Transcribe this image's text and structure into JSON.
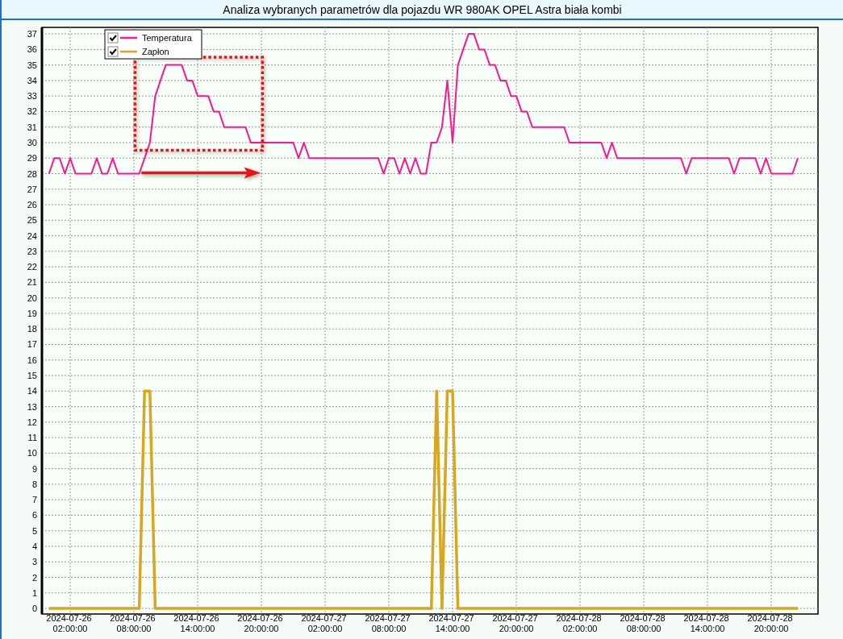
{
  "window": {
    "title": "Analiza wybranych parametrów dla pojazdu WR 980AK OPEL Astra biała kombi"
  },
  "chart": {
    "legend_checkboxes": [
      {
        "checked": true
      },
      {
        "checked": true
      }
    ],
    "chart_data": {
      "type": "line",
      "grid": true,
      "legend": true,
      "ylim": [
        -0.36,
        37.42
      ],
      "yticks": [
        0,
        1,
        2,
        3,
        4,
        5,
        6,
        7,
        8,
        9,
        10,
        11,
        12,
        13,
        14,
        15,
        16,
        17,
        18,
        19,
        20,
        21,
        22,
        23,
        24,
        25,
        26,
        27,
        28,
        29,
        30,
        31,
        32,
        33,
        34,
        35,
        36,
        37
      ],
      "categories": [
        null,
        null,
        null,
        null,
        "2024-07-26 02:00:00",
        null,
        null,
        null,
        null,
        null,
        null,
        null,
        null,
        null,
        null,
        null,
        "2024-07-26 08:00:00",
        null,
        null,
        null,
        null,
        null,
        null,
        null,
        null,
        null,
        null,
        null,
        "2024-07-26 14:00:00",
        null,
        null,
        null,
        null,
        null,
        null,
        null,
        null,
        null,
        null,
        null,
        "2024-07-26 20:00:00",
        null,
        null,
        null,
        null,
        null,
        null,
        null,
        null,
        null,
        null,
        null,
        "2024-07-27 02:00:00",
        null,
        null,
        null,
        null,
        null,
        null,
        null,
        null,
        null,
        null,
        null,
        "2024-07-27 08:00:00",
        null,
        null,
        null,
        null,
        null,
        null,
        null,
        null,
        null,
        null,
        null,
        "2024-07-27 14:00:00",
        null,
        null,
        null,
        null,
        null,
        null,
        null,
        null,
        null,
        null,
        null,
        "2024-07-27 20:00:00",
        null,
        null,
        null,
        null,
        null,
        null,
        null,
        null,
        null,
        null,
        null,
        "2024-07-28 02:00:00",
        null,
        null,
        null,
        null,
        null,
        null,
        null,
        null,
        null,
        null,
        null,
        "2024-07-28 08:00:00",
        null,
        null,
        null,
        null,
        null,
        null,
        null,
        null,
        null,
        null,
        null,
        "2024-07-28 14:00:00",
        null,
        null,
        null,
        null,
        null,
        null,
        null,
        null,
        null,
        null,
        null,
        "2024-07-28 20:00:00",
        null,
        null,
        null,
        null,
        null
      ],
      "series": [
        {
          "name": "Temperatura",
          "color": "#ff1493",
          "values": [
            28,
            29,
            29,
            28,
            29,
            28,
            28,
            28,
            28,
            29,
            28,
            28,
            29,
            28,
            28,
            28,
            28,
            28,
            29,
            30,
            33,
            34,
            35,
            35,
            35,
            35,
            34,
            34,
            33,
            33,
            33,
            32,
            32,
            31,
            31,
            31,
            31,
            31,
            30,
            30,
            30,
            30,
            30,
            30,
            30,
            30,
            30,
            29,
            30,
            29,
            29,
            29,
            29,
            29,
            29,
            29,
            29,
            29,
            29,
            29,
            29,
            29,
            29,
            28,
            29,
            29,
            28,
            29,
            28,
            29,
            28,
            28,
            30,
            30,
            31,
            34,
            30,
            35,
            36,
            37,
            37,
            36,
            36,
            35,
            35,
            34,
            34,
            33,
            33,
            32,
            32,
            31,
            31,
            31,
            31,
            31,
            31,
            31,
            30,
            30,
            30,
            30,
            30,
            30,
            30,
            29,
            30,
            29,
            29,
            29,
            29,
            29,
            29,
            29,
            29,
            29,
            29,
            29,
            29,
            29,
            28,
            29,
            29,
            29,
            29,
            29,
            29,
            29,
            29,
            28,
            29,
            29,
            29,
            29,
            28,
            29,
            28,
            28,
            28,
            28,
            28,
            29
          ]
        },
        {
          "name": "Zapłon",
          "color": "#daa520",
          "values": [
            0,
            0,
            0,
            0,
            0,
            0,
            0,
            0,
            0,
            0,
            0,
            0,
            0,
            0,
            0,
            0,
            0,
            0,
            14,
            14,
            0,
            0,
            0,
            0,
            0,
            0,
            0,
            0,
            0,
            0,
            0,
            0,
            0,
            0,
            0,
            0,
            0,
            0,
            0,
            0,
            0,
            0,
            0,
            0,
            0,
            0,
            0,
            0,
            0,
            0,
            0,
            0,
            0,
            0,
            0,
            0,
            0,
            0,
            0,
            0,
            0,
            0,
            0,
            0,
            0,
            0,
            0,
            0,
            0,
            0,
            0,
            0,
            0,
            14,
            0,
            14,
            14,
            0,
            0,
            0,
            0,
            0,
            0,
            0,
            0,
            0,
            0,
            0,
            0,
            0,
            0,
            0,
            0,
            0,
            0,
            0,
            0,
            0,
            0,
            0,
            0,
            0,
            0,
            0,
            0,
            0,
            0,
            0,
            0,
            0,
            0,
            0,
            0,
            0,
            0,
            0,
            0,
            0,
            0,
            0,
            0,
            0,
            0,
            0,
            0,
            0,
            0,
            0,
            0,
            0,
            0,
            0,
            0,
            0,
            0,
            0,
            0,
            0,
            0,
            0,
            0,
            0
          ]
        }
      ]
    }
  }
}
